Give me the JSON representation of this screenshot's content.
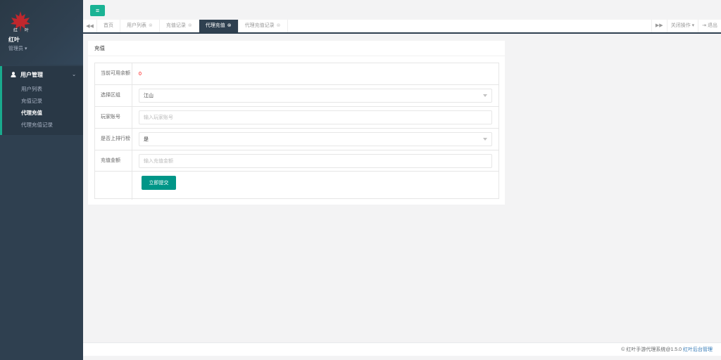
{
  "profile": {
    "name": "红叶",
    "role": "管理员",
    "role_caret": "▾"
  },
  "sidebar": {
    "group_label": "用户管理",
    "items": [
      {
        "label": "用户列表",
        "active": false
      },
      {
        "label": "充值记录",
        "active": false
      },
      {
        "label": "代理充值",
        "active": true
      },
      {
        "label": "代理充值记录",
        "active": false
      }
    ]
  },
  "topbar": {
    "menu_icon": "hamburger-icon"
  },
  "tabs": {
    "items": [
      {
        "label": "首页",
        "closable": false,
        "active": false
      },
      {
        "label": "用户列表",
        "closable": true,
        "active": false
      },
      {
        "label": "充值记录",
        "closable": true,
        "active": false
      },
      {
        "label": "代理充值",
        "closable": true,
        "active": true
      },
      {
        "label": "代理充值记录",
        "closable": true,
        "active": false
      }
    ],
    "close_ops": "关闭操作",
    "logout": "退出"
  },
  "panel": {
    "title": "充值",
    "balance_label": "当前可用余额",
    "balance_value": "0",
    "zone_label": "选择区组",
    "zone_value": "江山",
    "account_label": "玩家账号",
    "account_placeholder": "输入玩家账号",
    "rank_label": "是否上排行榜",
    "rank_value": "是",
    "amount_label": "充值金额",
    "amount_placeholder": "输入充值金额",
    "submit_label": "立即提交"
  },
  "footer": {
    "text": "© 红叶手游代理系统@1.5.0",
    "link": "红叶后台管理"
  },
  "colors": {
    "sidebar": "#2f4050",
    "accent": "#1ab394",
    "submit": "#009688",
    "balance": "#ff0000"
  }
}
